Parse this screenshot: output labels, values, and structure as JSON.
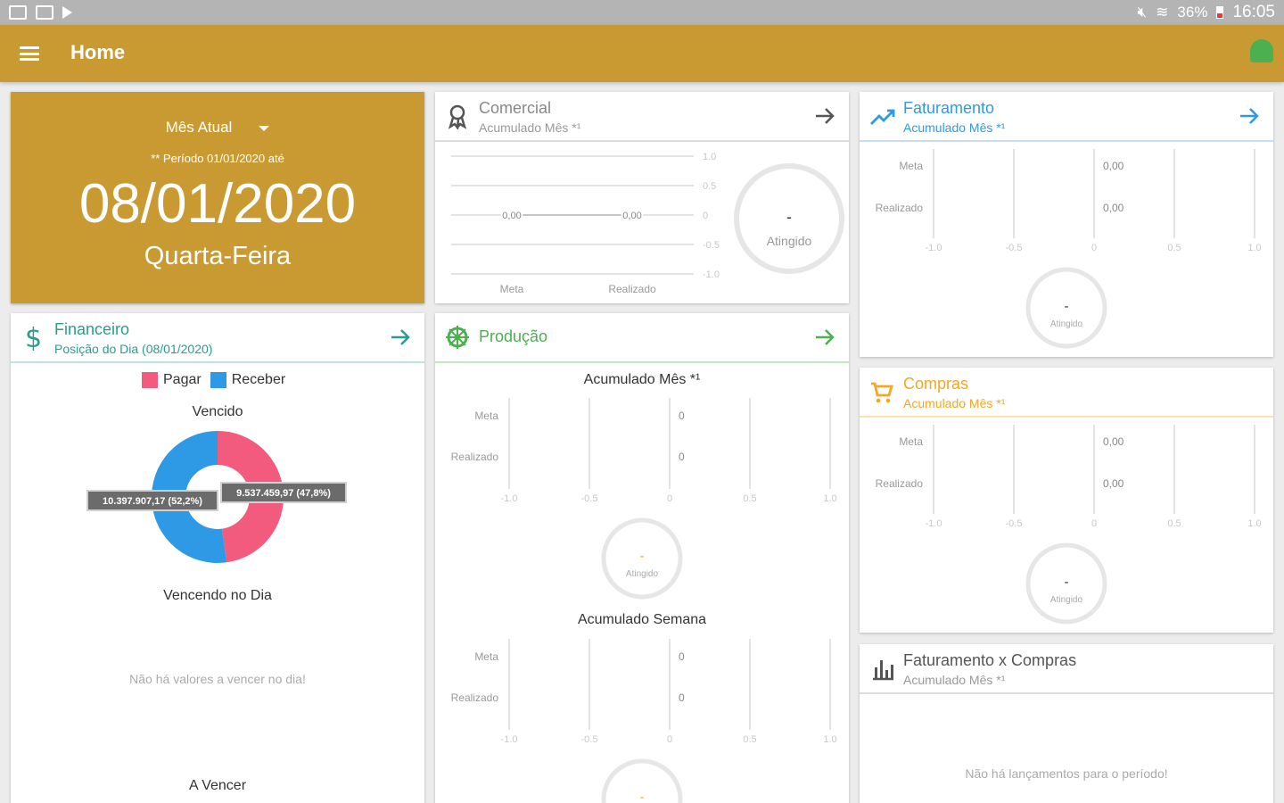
{
  "status_bar": {
    "battery": "36%",
    "time": "16:05"
  },
  "app_bar": {
    "title": "Home"
  },
  "date_card": {
    "period_select": "Mês Atual",
    "period_note": "** Período 01/01/2020 até",
    "date": "08/01/2020",
    "weekday": "Quarta-Feira"
  },
  "comercial": {
    "title": "Comercial",
    "subtitle": "Acumulado Mês *¹",
    "chart_data": {
      "type": "line",
      "categories": [
        "Meta",
        "Realizado"
      ],
      "series": [
        {
          "values": [
            0,
            0
          ]
        }
      ],
      "data_labels": [
        "0,00",
        "0,00"
      ],
      "yticks": [
        "1.0",
        "0.5",
        "0",
        "-0.5",
        "-1.0"
      ],
      "ylim": [
        -1,
        1
      ]
    },
    "gauge": {
      "value": "-",
      "label": "Atingido"
    }
  },
  "faturamento": {
    "title": "Faturamento",
    "subtitle": "Acumulado Mês *¹",
    "chart_data": {
      "type": "bar",
      "orientation": "horizontal",
      "categories": [
        "Meta",
        "Realizado"
      ],
      "values": [
        0,
        0
      ],
      "data_labels": [
        "0,00",
        "0,00"
      ],
      "xticks": [
        "-1.0",
        "-0.5",
        "0",
        "0.5",
        "1.0"
      ],
      "xlim": [
        -1,
        1
      ]
    },
    "gauge": {
      "value": "-",
      "label": "Atingido"
    }
  },
  "financeiro": {
    "title": "Financeiro",
    "subtitle": "Posição do Dia (08/01/2020)",
    "legend": [
      "Pagar",
      "Receber"
    ],
    "vencido": {
      "label": "Vencido",
      "chart_data": {
        "type": "pie",
        "categories": [
          "Pagar",
          "Receber"
        ],
        "values": [
          47.8,
          52.2
        ],
        "data_labels": [
          "9.537.459,97 (47,8%)",
          "10.397.907,17 (52,2%)"
        ],
        "colors": [
          "#f25b7d",
          "#2e9ae6"
        ]
      }
    },
    "vencendo": {
      "label": "Vencendo no Dia",
      "empty": "Não há valores a vencer no dia!"
    },
    "a_vencer": {
      "label": "A Vencer"
    }
  },
  "producao": {
    "title": "Produção",
    "mes": {
      "label": "Acumulado Mês *¹",
      "chart_data": {
        "type": "bar",
        "orientation": "horizontal",
        "categories": [
          "Meta",
          "Realizado"
        ],
        "values": [
          0,
          0
        ],
        "data_labels": [
          "0",
          "0"
        ],
        "xticks": [
          "-1.0",
          "-0.5",
          "0",
          "0.5",
          "1.0"
        ],
        "xlim": [
          -1,
          1
        ]
      },
      "gauge": {
        "value": "-",
        "label": "Atingido"
      }
    },
    "semana": {
      "label": "Acumulado Semana",
      "chart_data": {
        "type": "bar",
        "orientation": "horizontal",
        "categories": [
          "Meta",
          "Realizado"
        ],
        "values": [
          0,
          0
        ],
        "data_labels": [
          "0",
          "0"
        ],
        "xticks": [
          "-1.0",
          "-0.5",
          "0",
          "0.5",
          "1.0"
        ],
        "xlim": [
          -1,
          1
        ]
      },
      "gauge": {
        "value": "-"
      }
    }
  },
  "compras": {
    "title": "Compras",
    "subtitle": "Acumulado Mês *¹",
    "chart_data": {
      "type": "bar",
      "orientation": "horizontal",
      "categories": [
        "Meta",
        "Realizado"
      ],
      "values": [
        0,
        0
      ],
      "data_labels": [
        "0,00",
        "0,00"
      ],
      "xticks": [
        "-1.0",
        "-0.5",
        "0",
        "0.5",
        "1.0"
      ],
      "xlim": [
        -1,
        1
      ]
    },
    "gauge": {
      "value": "-",
      "label": "Atingido"
    }
  },
  "fat_compras": {
    "title": "Faturamento x Compras",
    "subtitle": "Acumulado Mês *¹",
    "empty": "Não há lançamentos para o período!"
  },
  "colors": {
    "appbar": "#c99a32",
    "teal": "#2a9d8f",
    "blue": "#2e9ae6",
    "green": "#4caf50",
    "orange": "#f5a623",
    "pink": "#f25b7d"
  }
}
